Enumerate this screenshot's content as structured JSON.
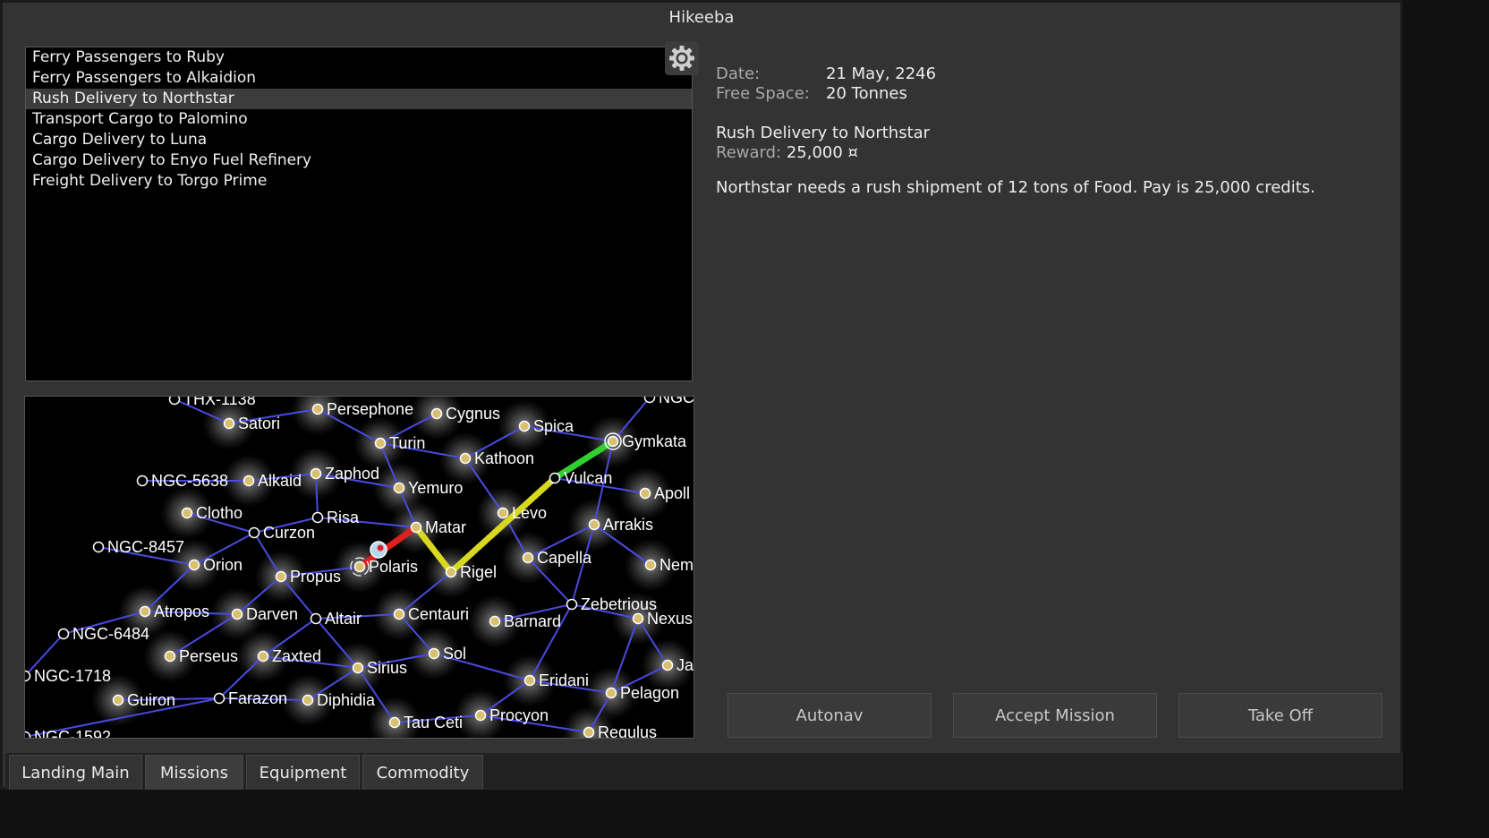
{
  "window": {
    "title": "Hikeeba"
  },
  "missions": {
    "items": [
      "Ferry Passengers to Ruby",
      "Ferry Passengers to Alkaidion",
      "Rush Delivery to Northstar",
      "Transport Cargo to Palomino",
      "Cargo Delivery to Luna",
      "Cargo Delivery to Enyo Fuel Refinery",
      "Freight Delivery to Torgo Prime"
    ],
    "selected_index": 2
  },
  "settings": {
    "icon": "gear-icon"
  },
  "info": {
    "date_label": "Date:",
    "date_value": "21 May, 2246",
    "space_label": "Free Space:",
    "space_value": "20 Tonnes"
  },
  "mission_detail": {
    "title": "Rush Delivery to Northstar",
    "reward_label": "Reward:",
    "reward_value": "25,000 ¤",
    "description": "Northstar needs a rush shipment of 12 tons of Food. Pay is 25,000 credits."
  },
  "buttons": {
    "autonav": "Autonav",
    "accept": "Accept Mission",
    "takeoff": "Take Off"
  },
  "tabs": [
    "Landing Main",
    "Missions",
    "Equipment",
    "Commodity"
  ],
  "active_tab": 1,
  "colors": {
    "lane": "#4a4ae0",
    "route_red": "#e02020",
    "route_yellow": "#d8d820",
    "route_green": "#30d030",
    "system_fill": "#d8c070"
  },
  "map": {
    "systems": [
      {
        "name": "THX-1138",
        "known": false
      },
      {
        "name": "Satori",
        "known": true
      },
      {
        "name": "Persephone",
        "known": true
      },
      {
        "name": "Cygnus",
        "known": true
      },
      {
        "name": "Spica",
        "known": true
      },
      {
        "name": "Gymkata",
        "known": true
      },
      {
        "name": "NGC",
        "known": false
      },
      {
        "name": "Turin",
        "known": true
      },
      {
        "name": "Kathoon",
        "known": true
      },
      {
        "name": "NGC-5638",
        "known": false
      },
      {
        "name": "Alkaid",
        "known": true
      },
      {
        "name": "Zaphod",
        "known": true
      },
      {
        "name": "Yemuro",
        "known": true
      },
      {
        "name": "Vulcan",
        "known": false
      },
      {
        "name": "Apoll",
        "known": true
      },
      {
        "name": "Clotho",
        "known": true
      },
      {
        "name": "Risa",
        "known": false
      },
      {
        "name": "Matar",
        "known": true
      },
      {
        "name": "Levo",
        "known": true
      },
      {
        "name": "Arrakis",
        "known": true
      },
      {
        "name": "Curzon",
        "known": false
      },
      {
        "name": "NGC-8457",
        "known": false
      },
      {
        "name": "Orion",
        "known": true
      },
      {
        "name": "Polaris",
        "known": true
      },
      {
        "name": "Propus",
        "known": true
      },
      {
        "name": "Rigel",
        "known": true
      },
      {
        "name": "Capella",
        "known": true
      },
      {
        "name": "Nem",
        "known": true
      },
      {
        "name": "Zebetrious",
        "known": false
      },
      {
        "name": "Atropos",
        "known": true
      },
      {
        "name": "Darven",
        "known": true
      },
      {
        "name": "Altair",
        "known": false
      },
      {
        "name": "Centauri",
        "known": true
      },
      {
        "name": "Barnard",
        "known": true
      },
      {
        "name": "Nexus",
        "known": true
      },
      {
        "name": "NGC-6484",
        "known": false
      },
      {
        "name": "Perseus",
        "known": true
      },
      {
        "name": "Zaxted",
        "known": true
      },
      {
        "name": "Sirius",
        "known": true
      },
      {
        "name": "Sol",
        "known": true
      },
      {
        "name": "Ja",
        "known": true
      },
      {
        "name": "NGC-1718",
        "known": false
      },
      {
        "name": "Eridani",
        "known": true
      },
      {
        "name": "Pelagon",
        "known": true
      },
      {
        "name": "Guiron",
        "known": true
      },
      {
        "name": "Farazon",
        "known": false
      },
      {
        "name": "Diphidia",
        "known": true
      },
      {
        "name": "Tau Ceti",
        "known": true
      },
      {
        "name": "Procyon",
        "known": true
      },
      {
        "name": "Regulus",
        "known": true
      },
      {
        "name": "NGC-1592",
        "known": false
      }
    ]
  }
}
